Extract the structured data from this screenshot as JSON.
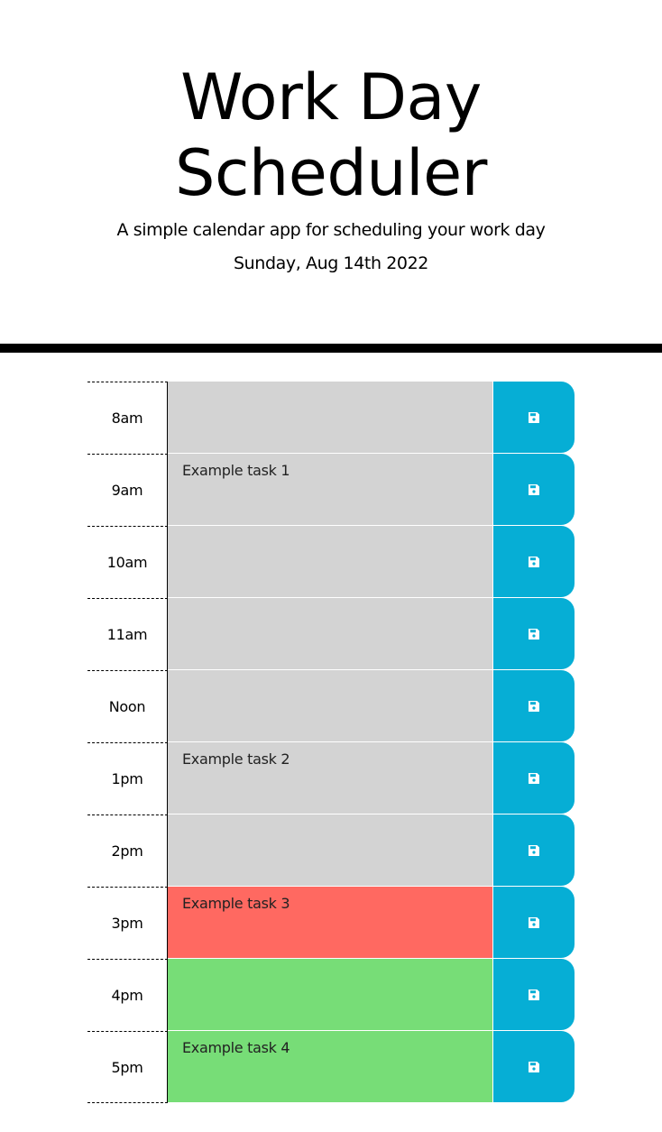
{
  "header": {
    "title": "Work Day Scheduler",
    "lead": "A simple calendar app for scheduling your work day",
    "current_day": "Sunday, Aug 14th 2022"
  },
  "colors": {
    "past": "#d3d3d3",
    "present": "#ff6961",
    "future": "#77dd77",
    "save_button": "#06aed5"
  },
  "time_blocks": [
    {
      "hour": "8am",
      "task": "",
      "state": "past",
      "save_icon": "floppy-disk-icon"
    },
    {
      "hour": "9am",
      "task": "Example task 1",
      "state": "past",
      "save_icon": "floppy-disk-icon"
    },
    {
      "hour": "10am",
      "task": "",
      "state": "past",
      "save_icon": "floppy-disk-icon"
    },
    {
      "hour": "11am",
      "task": "",
      "state": "past",
      "save_icon": "floppy-disk-icon"
    },
    {
      "hour": "Noon",
      "task": "",
      "state": "past",
      "save_icon": "floppy-disk-icon"
    },
    {
      "hour": "1pm",
      "task": "Example task 2",
      "state": "past",
      "save_icon": "floppy-disk-icon"
    },
    {
      "hour": "2pm",
      "task": "",
      "state": "past",
      "save_icon": "floppy-disk-icon"
    },
    {
      "hour": "3pm",
      "task": "Example task 3",
      "state": "present",
      "save_icon": "floppy-disk-icon"
    },
    {
      "hour": "4pm",
      "task": "",
      "state": "future",
      "save_icon": "floppy-disk-icon"
    },
    {
      "hour": "5pm",
      "task": "Example task 4",
      "state": "future",
      "save_icon": "floppy-disk-icon"
    }
  ]
}
